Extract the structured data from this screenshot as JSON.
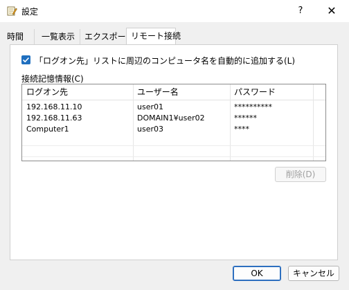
{
  "window": {
    "title": "設定",
    "help_label": "?",
    "close_label": "✕"
  },
  "tabs": [
    {
      "label": "時間"
    },
    {
      "label": "一覧表示"
    },
    {
      "label": "エクスポート"
    },
    {
      "label": "リモート接続"
    }
  ],
  "remote": {
    "checkbox_label": "「ログオン先」リストに周辺のコンピュータ名を自動的に追加する(L)",
    "checkbox_checked": true,
    "group_label": "接続記憶情報(C)",
    "columns": [
      "ログオン先",
      "ユーザー名",
      "パスワード"
    ],
    "rows": [
      {
        "host": "192.168.11.10",
        "user": "user01",
        "password": "**********"
      },
      {
        "host": "192.168.11.63",
        "user": "DOMAIN1¥user02",
        "password": "******"
      },
      {
        "host": "Computer1",
        "user": "user03",
        "password": "****"
      }
    ],
    "delete_label": "削除(D)"
  },
  "footer": {
    "ok_label": "OK",
    "cancel_label": "キャンセル"
  },
  "colors": {
    "accent": "#1f6fbf",
    "window_bg": "#f0f0f0",
    "panel_bg": "#ffffff"
  }
}
